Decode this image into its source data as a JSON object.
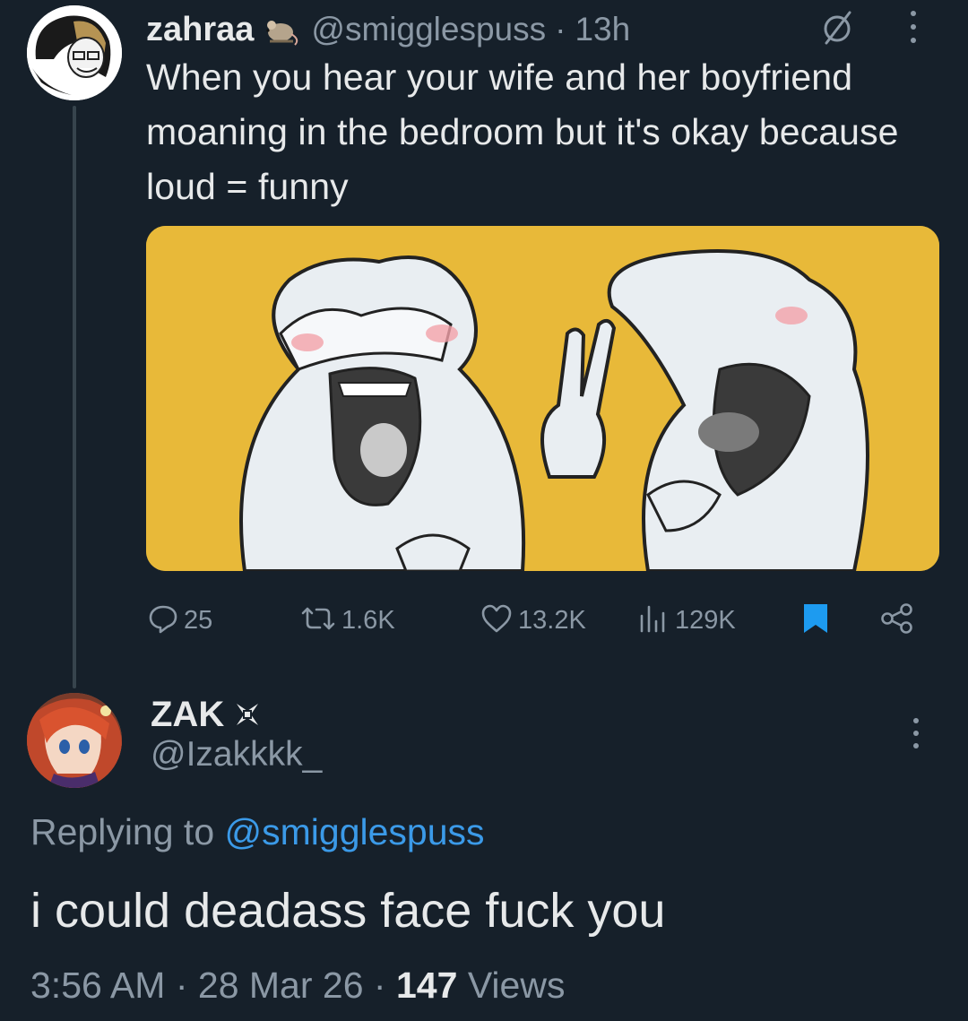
{
  "parent_tweet": {
    "display_name": "zahraa",
    "handle": "@smigglespuss",
    "separator": "·",
    "time": "13h",
    "text": "When you hear your wife and her boyfriend moaning in the bedroom but it's okay because loud = funny",
    "stats": {
      "replies": "25",
      "reposts": "1.6K",
      "likes": "13.2K",
      "views": "129K"
    },
    "icons": [
      "rat-icon",
      "no-entry-icon",
      "more-icon",
      "reply-icon",
      "repost-icon",
      "like-icon",
      "views-icon",
      "bookmark-icon",
      "share-icon"
    ]
  },
  "reply_tweet": {
    "display_name": "ZAK",
    "handle": "@Izakkkk_",
    "replying_label": "Replying to",
    "replying_handle": "@smigglespuss",
    "text": "i could deadass face fuck you",
    "time": "3:56 AM",
    "separator": "·",
    "date": "28 Mar 26",
    "views_count": "147",
    "views_label": "Views"
  },
  "colors": {
    "background": "#16202a",
    "primary_text": "#e7e9ea",
    "secondary_text": "#8b98a5",
    "link": "#3b9ae8",
    "bookmark_active": "#1d9bf0",
    "media_background": "#e8b939"
  }
}
